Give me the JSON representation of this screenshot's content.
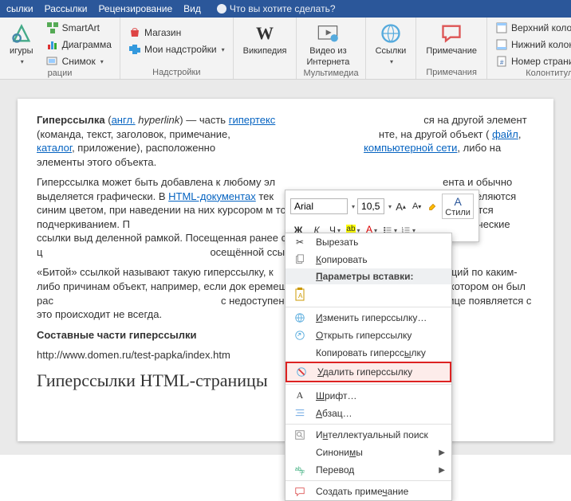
{
  "tabs": {
    "items": [
      "сылки",
      "Рассылки",
      "Рецензирование",
      "Вид"
    ],
    "tellme": "Что вы хотите сделать?"
  },
  "ribbon": {
    "group0": {
      "figures": "игуры",
      "snapshot": "Снимок",
      "label": "рации",
      "smartart": "SmartArt",
      "diagram": "Диаграмма"
    },
    "group1": {
      "store": "Магазин",
      "addins": "Мои надстройки",
      "label": "Надстройки"
    },
    "group2": {
      "wiki": "Википедия"
    },
    "group3": {
      "video_l1": "Видео из",
      "video_l2": "Интернета",
      "label": "Мультимедиа"
    },
    "group4": {
      "links": "Ссылки"
    },
    "group5": {
      "comment": "Примечание",
      "label": "Примечания"
    },
    "group6": {
      "header": "Верхний колонтитул",
      "footer": "Нижний колонтитул",
      "pagenum": "Номер страницы",
      "label": "Колонтитулы"
    }
  },
  "mini": {
    "font": "Arial",
    "size": "10,5",
    "b": "Ж",
    "i": "К",
    "u": "Ч",
    "styles_big": "А",
    "styles_label": "Стили"
  },
  "context": {
    "cut": "Вырезать",
    "copy": "Копировать",
    "paste_section": "Параметры вставки:",
    "edit_link": "Изменить гиперссылку…",
    "open_link": "Открыть гиперссылку",
    "copy_link": "Копировать гиперссылку",
    "remove_link": "Удалить гиперссылку",
    "font": "Шрифт…",
    "para": "Абзац…",
    "smart": "Интеллектуальный поиск",
    "syn": "Синонимы",
    "translate": "Перевод",
    "new_comment": "Создать примечание"
  },
  "doc": {
    "p1_a": "Гиперссылка",
    "p1_b": " (",
    "p1_link1": "англ.",
    "p1_c": " ",
    "p1_i": "hyperlink",
    "p1_d": ") — часть ",
    "p1_link2": "гипертекс",
    "p1_e": "ся на другой элемент (команда, текст, заголовок, примечание,",
    "p1_f": "нте, на другой объект (",
    "p1_link3": "файл",
    "p1_g": ", ",
    "p1_link4": "каталог",
    "p1_h": ", приложение), расположенно",
    "p1_link5": "компьютерной сети",
    "p1_i2": ", либо на элементы этого объекта.",
    "p2_a": "Гиперссылка может быть добавлена к любому эл",
    "p2_b": "ента и обычно выделяется графически. В ",
    "p2_link": "HTML-документах",
    "p2_c": " тек",
    "p2_d": "выделяются синим цветом, при наведении на них курсором м",
    "p2_e": "тся, например, меняют цвет или выделяются подчеркиванием. П",
    "p2_f": "ощью клавиатуры текстовые и графические ссылки выд",
    "p2_g": "деленной рамкой. Посещенная ранее ссылка обычно выделяется ц",
    "p2_h": "осещённой ссылки.",
    "p3_a": "«Битой» ссылкой называют такую гиперссылку, к",
    "p3_b": "ющий по каким-либо причинам объект, например, если док",
    "p3_c": "еремещен администратором ресурса, на котором он был рас",
    "p3_d": "с недоступен. Обычно в таком случае на странице появляется с",
    "p3_e": "это происходит не всегда.",
    "h2": "Составные части гиперссылки",
    "url": "http://www.domen.ru/test-papka/index.htm",
    "h1": "Гиперссылки HTML-страницы"
  }
}
